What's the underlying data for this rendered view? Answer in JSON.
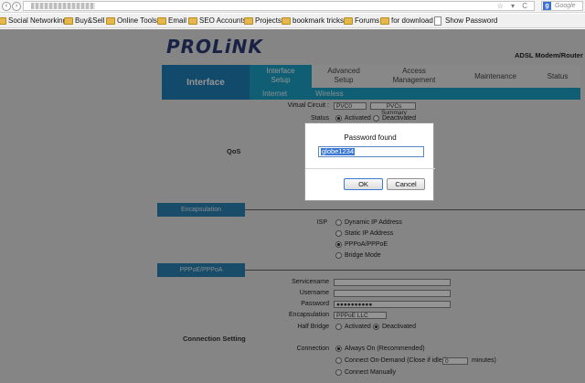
{
  "browser": {
    "url_icons": "☆ ▾ C",
    "search_engine_label": "g",
    "search_placeholder": "Google",
    "bookmarks": [
      {
        "label": "Social Networking",
        "type": "folder"
      },
      {
        "label": "Buy&Sell",
        "type": "folder"
      },
      {
        "label": "Online Tools",
        "type": "folder"
      },
      {
        "label": "Email",
        "type": "folder"
      },
      {
        "label": "SEO Accounts",
        "type": "folder"
      },
      {
        "label": "Projects",
        "type": "folder"
      },
      {
        "label": "bookmark tricks",
        "type": "folder"
      },
      {
        "label": "Forums",
        "type": "folder"
      },
      {
        "label": "for download",
        "type": "folder"
      },
      {
        "label": "Show Password",
        "type": "page"
      }
    ]
  },
  "router": {
    "logo": "PROLiNK",
    "model": "ADSL Modem/Router",
    "menu": {
      "active": "Interface",
      "items": [
        "Interface Setup",
        "Advanced Setup",
        "Access Management",
        "Maintenance",
        "Status"
      ]
    },
    "submenu": [
      "Internet",
      "Wireless"
    ],
    "vc": {
      "label": "Virtual Circuit :",
      "value": "PVC0",
      "summary_button": "PVCs Summary"
    },
    "status": {
      "label": "Status",
      "activated": "Activated",
      "deactivated": "Deactivated"
    },
    "sections": {
      "qos": "QoS",
      "encapsulation": "Encapsulation",
      "pppoe": "PPPoE/PPPoA",
      "connection": "Connection Setting"
    },
    "isp": {
      "label": "ISP",
      "options": [
        "Dynamic IP Address",
        "Static IP Address",
        "PPPoA/PPPoE",
        "Bridge Mode"
      ]
    },
    "pppoe_fields": {
      "servicename_label": "Servicename",
      "username_label": "Username",
      "password_label": "Password",
      "password_value": "●●●●●●●●●●",
      "encapsulation_label": "Encapsulation",
      "encapsulation_value": "PPPoE LLC",
      "halfbridge_label": "Half Bridge",
      "activated": "Activated",
      "deactivated": "Deactivated"
    },
    "connection": {
      "label": "Connection",
      "always_on": "Always On (Recommended)",
      "on_demand": "Connect On-Demand (Close if idle for",
      "on_demand_value": "0",
      "on_demand_unit": "minutes)",
      "manually": "Connect Manually"
    }
  },
  "dialog": {
    "title": "Password found",
    "value": "globe1234",
    "ok": "OK",
    "cancel": "Cancel"
  }
}
